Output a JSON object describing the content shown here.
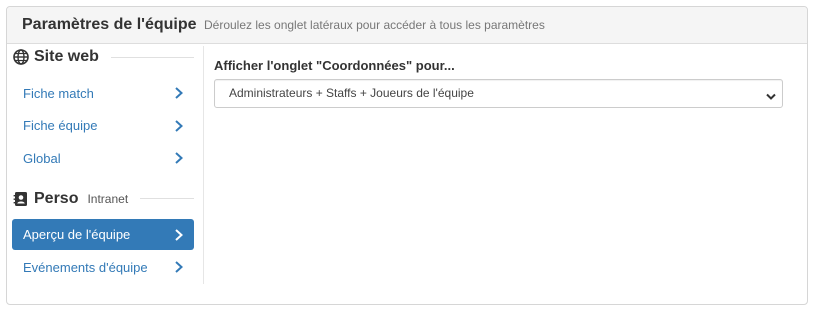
{
  "header": {
    "title": "Paramètres de l'équipe",
    "subtitle": "Déroulez les onglet latéraux pour accéder à tous les paramètres"
  },
  "sidebar": {
    "sections": [
      {
        "title": "Site web",
        "icon": "globe-icon",
        "items": [
          {
            "label": "Fiche match"
          },
          {
            "label": "Fiche équipe"
          },
          {
            "label": "Global"
          }
        ]
      },
      {
        "title": "Perso",
        "subtitle": "Intranet",
        "icon": "contact-card-icon",
        "items": [
          {
            "label": "Aperçu de l'équipe",
            "active": true
          },
          {
            "label": "Evénements d'équipe"
          }
        ]
      }
    ]
  },
  "main": {
    "field_label": "Afficher l'onglet \"Coordonnées\" pour...",
    "select_value": "Administrateurs + Staffs + Joueurs de l'équipe"
  },
  "colors": {
    "accent": "#337ab7",
    "heading_bg": "#f5f5f5",
    "border": "#d6d6d6"
  }
}
